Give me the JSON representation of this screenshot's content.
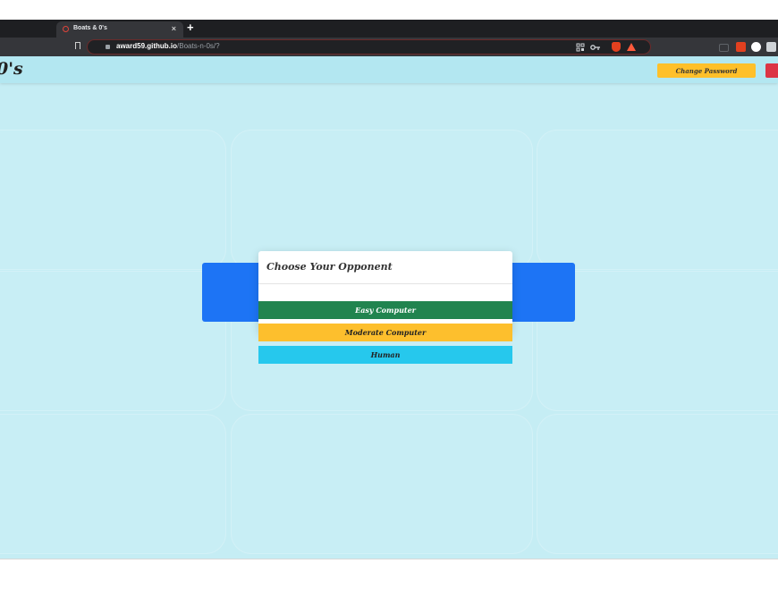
{
  "browser": {
    "tab_title": "Boats & 0's",
    "tab_close": "×",
    "new_tab": "+",
    "url_host": "award59.github.io",
    "url_path": "/Boats-n-0s/?"
  },
  "navbar": {
    "brand": "0's",
    "change_password": "Change Password"
  },
  "modal": {
    "title": "Choose Your Opponent",
    "options": [
      {
        "label": "Easy Computer",
        "color": "#21844f"
      },
      {
        "label": "Moderate Computer",
        "color": "#fdbf2d"
      },
      {
        "label": "Human",
        "color": "#26c8ed"
      }
    ]
  },
  "colors": {
    "page_bg": "#c5edf4",
    "primary": "#1d74f5",
    "warning": "#ffc02a",
    "danger": "#dc3545"
  },
  "icons": [
    "favicon-icon",
    "bookmark-icon",
    "lock-icon",
    "qr-icon",
    "key-icon",
    "brave-shield-icon",
    "brave-rewards-icon",
    "extension-icon"
  ]
}
